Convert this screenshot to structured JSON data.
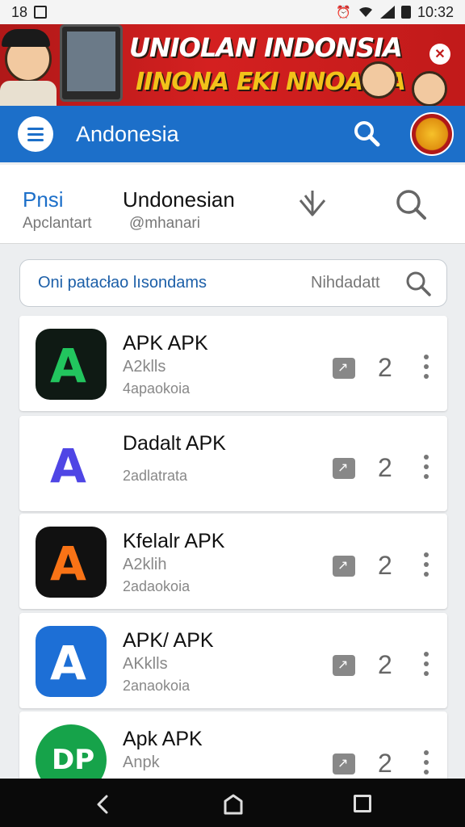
{
  "status_bar": {
    "left_text": "18",
    "time": "10:32",
    "icons": [
      "notification-box-icon",
      "alarm-icon",
      "wifi-icon",
      "signal-icon",
      "battery-icon"
    ]
  },
  "banner": {
    "title": "UNIOLAN INDONSIA",
    "subtitle": "IINONA EKI NNOASIA",
    "close_symbol": "✕"
  },
  "app_bar": {
    "title": "Andonesia",
    "icons": [
      "menu-icon",
      "search-icon",
      "emblem-icon"
    ]
  },
  "profile": {
    "tab_title": "Pnsi",
    "tab_sub": "Apclantart",
    "name": "Undonesian",
    "handle": "@mhanari"
  },
  "search": {
    "hint": "Oni patacłao lısondams",
    "filter_label": "Nihdadatt"
  },
  "apps": [
    {
      "name": "APK APK",
      "sub1": "A2klls",
      "sub2": "4apaokoia",
      "count": "2",
      "glyph": "A",
      "bg": "#0f1a14",
      "accent": "#22c55e"
    },
    {
      "name": "Dadalt APK",
      "sub1": "",
      "sub2": "2adlatrata",
      "count": "2",
      "glyph": "A",
      "bg": "#ffffff",
      "accent": "#4f46e5"
    },
    {
      "name": "Kfelalr APK",
      "sub1": "A2klih",
      "sub2": "2adaokoia",
      "count": "2",
      "glyph": "A",
      "bg": "#111111",
      "accent": "#f97316"
    },
    {
      "name": "APK/ APK",
      "sub1": "AKklls",
      "sub2": "2anaokoia",
      "count": "2",
      "glyph": "A",
      "bg": "#1d6fd6",
      "accent": "#ffffff"
    },
    {
      "name": "Apk APK",
      "sub1": "Anpk",
      "sub2": "",
      "count": "2",
      "glyph": "DP",
      "bg": "#16a34a",
      "accent": "#ffffff"
    }
  ],
  "colors": {
    "primary": "#1c6fc9",
    "banner_red": "#c11a1a",
    "banner_yellow": "#f2c21a"
  }
}
